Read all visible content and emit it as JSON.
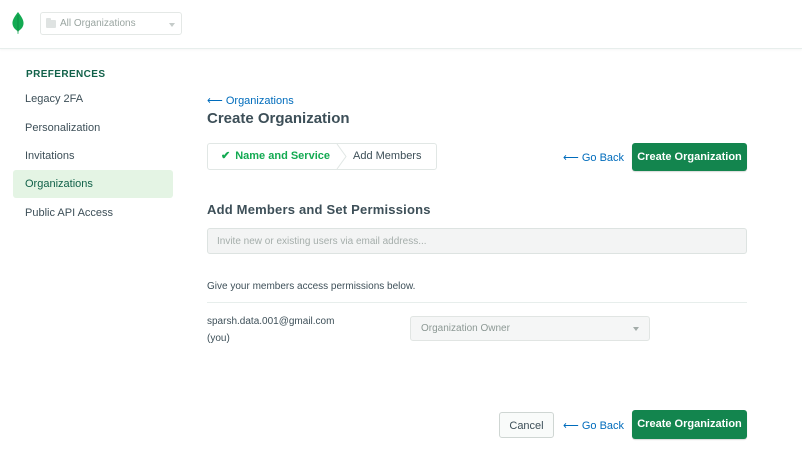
{
  "topbar": {
    "org_selector": "All Organizations"
  },
  "sidebar": {
    "heading": "PREFERENCES",
    "items": [
      {
        "label": "Legacy 2FA",
        "active": false
      },
      {
        "label": "Personalization",
        "active": false
      },
      {
        "label": "Invitations",
        "active": false
      },
      {
        "label": "Organizations",
        "active": true
      },
      {
        "label": "Public API Access",
        "active": false
      }
    ]
  },
  "main": {
    "back_link": "Organizations",
    "title": "Create Organization",
    "steps": [
      {
        "label": "Name and Service",
        "status": "complete"
      },
      {
        "label": "Add Members",
        "status": "current"
      }
    ],
    "go_back": "Go Back",
    "create_button": "Create Organization",
    "section_title": "Add Members and Set Permissions",
    "invite_placeholder": "Invite new or existing users via email address...",
    "permissions_hint": "Give your members access permissions below.",
    "member": {
      "email": "sparsh.data.001@gmail.com",
      "note": "(you)",
      "role": "Organization Owner"
    },
    "cancel_button": "Cancel"
  },
  "colors": {
    "brand_green": "#13854e",
    "link_blue": "#006cbc",
    "success_green": "#13aa52",
    "active_bg": "#e4f4e4"
  },
  "icons": {
    "logo": "mongodb-leaf-icon",
    "folder": "folder-icon",
    "check": "check-icon",
    "arrow": "arrow-left-icon",
    "caret": "caret-down-icon"
  }
}
